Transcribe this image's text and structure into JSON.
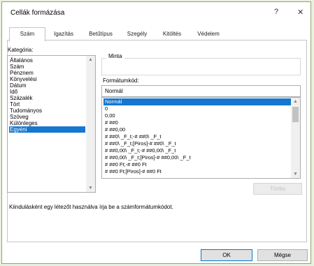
{
  "window": {
    "title": "Cellák formázása",
    "help": "?",
    "close": "✕"
  },
  "tabs": [
    {
      "label": "Szám"
    },
    {
      "label": "Igazítás"
    },
    {
      "label": "Betűtípus"
    },
    {
      "label": "Szegély"
    },
    {
      "label": "Kitöltés"
    },
    {
      "label": "Védelem"
    }
  ],
  "category": {
    "label": "Kategória:",
    "items": [
      "Általános",
      "Szám",
      "Pénznem",
      "Könyvelési",
      "Dátum",
      "Idő",
      "Százalék",
      "Tört",
      "Tudományos",
      "Szöveg",
      "Különleges",
      "Egyéni"
    ],
    "selected": "Egyéni"
  },
  "sample": {
    "label": "Minta"
  },
  "format_code": {
    "label": "Formátumkód:",
    "value": "Normál",
    "items": [
      "Normál",
      "0",
      "0,00",
      "# ##0",
      "# ##0,00",
      "# ##0\\ _F_t;-# ##0\\ _F_t",
      "# ##0\\ _F_t;[Piros]-# ##0\\ _F_t",
      "# ##0,00\\ _F_t;-# ##0,00\\ _F_t",
      "# ##0,00\\ _F_t;[Piros]-# ##0,00\\ _F_t",
      "# ##0 Ft;-# ##0 Ft",
      "# ##0 Ft;[Piros]-# ##0 Ft"
    ],
    "selected": "Normál"
  },
  "delete_button": "Törlés",
  "description": "Kiindulásként egy létezőt használva írja be a számformátumkódot.",
  "ok_button": "OK",
  "cancel_button": "Mégse"
}
